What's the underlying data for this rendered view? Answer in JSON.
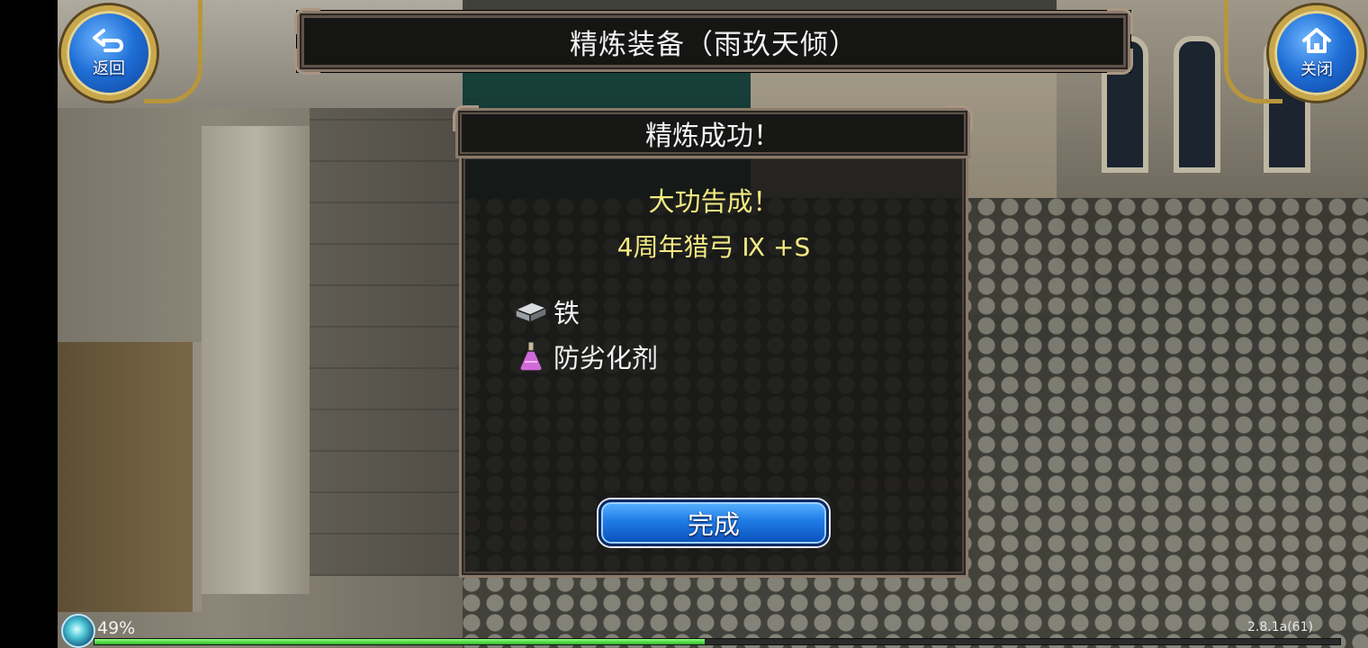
{
  "header": {
    "title": "精炼装备（雨玖天倾）",
    "back_label": "返回",
    "close_label": "关闭"
  },
  "dialog": {
    "title": "精炼成功！",
    "message": "大功告成！",
    "item_name": "4周年猎弓 Ⅸ +S",
    "materials": [
      {
        "name": "铁",
        "icon": "iron-ingot-icon"
      },
      {
        "name": "防劣化剂",
        "icon": "potion-flask-icon"
      }
    ],
    "done_label": "完成"
  },
  "status": {
    "percent_label": "49%",
    "progress": 0.49,
    "version": "2.8.1a(61)"
  },
  "colors": {
    "accent_yellow": "#f3ea82",
    "button_blue": "#1f7ce6",
    "frame": "#8a7a6a",
    "progress_green": "#2fb82a"
  }
}
